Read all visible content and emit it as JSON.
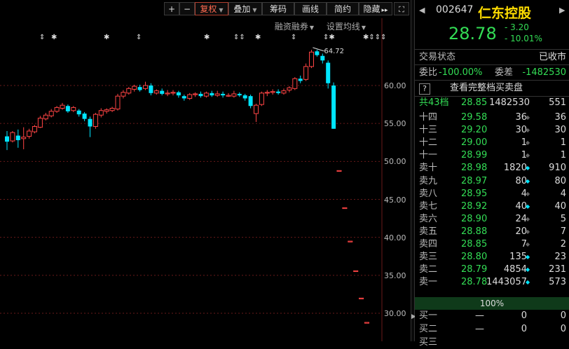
{
  "toolbar": {
    "plus": "+",
    "minus": "−",
    "fuquan": "复权",
    "diejia": "叠加",
    "chouma": "筹码",
    "huaxian": "画线",
    "jianyue": "简约",
    "yincang": "隐藏",
    "expand": "▸▸"
  },
  "subbar": {
    "rongzi": "融资融券",
    "ma": "设置均线"
  },
  "markers": [
    "⇕",
    "✱",
    "✱",
    "⇕",
    "✱",
    "⇕⇕",
    "✱",
    "⇕",
    "⇕✱",
    "✱⇕⇕⇕",
    "✱"
  ],
  "colors": {
    "up": "#ff4444",
    "down": "#00e5ff",
    "grid": "#6a1a1a",
    "green": "#33dd55",
    "name": "#ffdd00"
  },
  "chart_data": {
    "type": "candlestick",
    "y_ticks": [
      "60.00",
      "55.00",
      "50.00",
      "45.00",
      "40.00",
      "35.00",
      "30.00"
    ],
    "ylim": [
      28.5,
      65.5
    ],
    "high_label": "64.72",
    "candles": [
      {
        "o": 53.3,
        "c": 52.6,
        "h": 54.0,
        "l": 51.5
      },
      {
        "o": 52.7,
        "c": 53.8,
        "h": 54.0,
        "l": 52.5
      },
      {
        "o": 53.4,
        "c": 52.8,
        "h": 54.2,
        "l": 51.8
      },
      {
        "o": 53.0,
        "c": 53.2,
        "h": 54.5,
        "l": 51.6
      },
      {
        "o": 53.3,
        "c": 54.0,
        "h": 54.3,
        "l": 53.0
      },
      {
        "o": 53.9,
        "c": 54.6,
        "h": 54.8,
        "l": 53.7
      },
      {
        "o": 54.5,
        "c": 55.7,
        "h": 56.0,
        "l": 54.4
      },
      {
        "o": 55.6,
        "c": 56.1,
        "h": 56.4,
        "l": 55.4
      },
      {
        "o": 56.0,
        "c": 56.6,
        "h": 56.9,
        "l": 55.8
      },
      {
        "o": 56.6,
        "c": 57.1,
        "h": 57.3,
        "l": 56.4
      },
      {
        "o": 57.0,
        "c": 57.4,
        "h": 57.7,
        "l": 56.8
      },
      {
        "o": 57.3,
        "c": 56.6,
        "h": 57.5,
        "l": 56.4
      },
      {
        "o": 56.7,
        "c": 57.1,
        "h": 57.3,
        "l": 56.5
      },
      {
        "o": 56.7,
        "c": 56.2,
        "h": 56.9,
        "l": 55.9
      },
      {
        "o": 56.3,
        "c": 55.6,
        "h": 56.5,
        "l": 55.3
      },
      {
        "o": 55.6,
        "c": 54.6,
        "h": 55.9,
        "l": 53.2
      },
      {
        "o": 54.6,
        "c": 56.2,
        "h": 56.4,
        "l": 54.3
      },
      {
        "o": 56.1,
        "c": 56.7,
        "h": 57.0,
        "l": 55.8
      },
      {
        "o": 56.6,
        "c": 56.8,
        "h": 57.0,
        "l": 56.3
      },
      {
        "o": 56.7,
        "c": 57.0,
        "h": 57.2,
        "l": 56.5
      },
      {
        "o": 56.9,
        "c": 58.6,
        "h": 58.9,
        "l": 56.7
      },
      {
        "o": 58.6,
        "c": 59.1,
        "h": 59.4,
        "l": 58.3
      },
      {
        "o": 59.0,
        "c": 59.6,
        "h": 59.8,
        "l": 58.8
      },
      {
        "o": 59.5,
        "c": 59.9,
        "h": 60.1,
        "l": 59.2
      },
      {
        "o": 59.8,
        "c": 59.4,
        "h": 60.1,
        "l": 59.2
      },
      {
        "o": 59.6,
        "c": 60.0,
        "h": 60.5,
        "l": 59.4
      },
      {
        "o": 60.0,
        "c": 59.0,
        "h": 60.3,
        "l": 58.7
      },
      {
        "o": 59.0,
        "c": 59.3,
        "h": 59.5,
        "l": 58.8
      },
      {
        "o": 59.3,
        "c": 58.9,
        "h": 59.6,
        "l": 58.7
      },
      {
        "o": 58.9,
        "c": 59.0,
        "h": 59.4,
        "l": 58.6
      },
      {
        "o": 59.0,
        "c": 59.1,
        "h": 59.4,
        "l": 58.7
      },
      {
        "o": 59.1,
        "c": 58.7,
        "h": 59.3,
        "l": 58.4
      },
      {
        "o": 58.6,
        "c": 58.3,
        "h": 58.8,
        "l": 58.0
      },
      {
        "o": 58.3,
        "c": 58.8,
        "h": 59.0,
        "l": 58.1
      },
      {
        "o": 58.8,
        "c": 58.9,
        "h": 59.1,
        "l": 58.5
      },
      {
        "o": 58.9,
        "c": 58.6,
        "h": 59.2,
        "l": 58.4
      },
      {
        "o": 58.6,
        "c": 59.0,
        "h": 59.2,
        "l": 58.4
      },
      {
        "o": 59.0,
        "c": 58.7,
        "h": 59.3,
        "l": 58.5
      },
      {
        "o": 58.7,
        "c": 58.9,
        "h": 59.3,
        "l": 58.5
      },
      {
        "o": 58.9,
        "c": 58.7,
        "h": 59.2,
        "l": 58.4
      },
      {
        "o": 58.7,
        "c": 58.7,
        "h": 59.0,
        "l": 58.5
      },
      {
        "o": 58.6,
        "c": 58.9,
        "h": 59.3,
        "l": 58.4
      },
      {
        "o": 58.9,
        "c": 58.7,
        "h": 59.1,
        "l": 58.5
      },
      {
        "o": 58.7,
        "c": 58.3,
        "h": 58.9,
        "l": 58.0
      },
      {
        "o": 58.6,
        "c": 57.3,
        "h": 58.8,
        "l": 57.0
      },
      {
        "o": 56.3,
        "c": 57.4,
        "h": 57.6,
        "l": 55.2
      },
      {
        "o": 57.5,
        "c": 59.0,
        "h": 59.2,
        "l": 57.3
      },
      {
        "o": 59.0,
        "c": 59.1,
        "h": 59.4,
        "l": 58.6
      },
      {
        "o": 59.1,
        "c": 59.2,
        "h": 59.5,
        "l": 58.8
      },
      {
        "o": 59.2,
        "c": 59.0,
        "h": 59.5,
        "l": 58.8
      },
      {
        "o": 59.0,
        "c": 59.3,
        "h": 59.6,
        "l": 58.8
      },
      {
        "o": 59.4,
        "c": 59.7,
        "h": 59.9,
        "l": 59.1
      },
      {
        "o": 59.6,
        "c": 60.9,
        "h": 61.1,
        "l": 59.4
      },
      {
        "o": 60.9,
        "c": 60.6,
        "h": 61.3,
        "l": 60.3
      },
      {
        "o": 60.8,
        "c": 62.5,
        "h": 62.9,
        "l": 60.6
      },
      {
        "o": 62.5,
        "c": 64.4,
        "h": 64.7,
        "l": 62.3
      },
      {
        "o": 64.5,
        "c": 64.0,
        "h": 64.72,
        "l": 63.8
      },
      {
        "o": 63.9,
        "c": 63.3,
        "h": 64.2,
        "l": 62.9
      },
      {
        "o": 63.0,
        "c": 60.3,
        "h": 63.3,
        "l": 59.6
      },
      {
        "o": 60.0,
        "c": 54.3,
        "h": 60.4,
        "l": 54.3
      },
      {
        "o": 48.8,
        "c": 48.8,
        "h": 48.8,
        "l": 48.8
      },
      {
        "o": 43.9,
        "c": 43.9,
        "h": 43.9,
        "l": 43.9
      },
      {
        "o": 39.5,
        "c": 39.5,
        "h": 39.5,
        "l": 39.5
      },
      {
        "o": 35.6,
        "c": 35.6,
        "h": 35.6,
        "l": 35.6
      },
      {
        "o": 32.0,
        "c": 32.0,
        "h": 32.0,
        "l": 32.0
      },
      {
        "o": 28.8,
        "c": 28.8,
        "h": 28.8,
        "l": 28.8
      }
    ]
  },
  "quote": {
    "code": "002647",
    "name": "仁东控股",
    "price": "28.78",
    "change": "- 3.20",
    "pct": "- 10.01%",
    "status_label": "交易状态",
    "status_value": "已收市",
    "weibi_label": "委比",
    "weibi_value": "-100.00%",
    "weicha_label": "委差",
    "weicha_value": "-1482530",
    "view_all": "查看完整档买卖盘",
    "help": "?",
    "total_label": "共43档",
    "total_price": "28.85",
    "total_vol": "1482530",
    "total_right": "551",
    "ask_rows": [
      {
        "label": "十四",
        "price": "29.58",
        "vol": "36",
        "right": "36",
        "dot": "◆",
        "dot_color": "#666"
      },
      {
        "label": "十三",
        "price": "29.20",
        "vol": "30",
        "right": "30",
        "dot": "◆",
        "dot_color": "#666"
      },
      {
        "label": "十二",
        "price": "29.00",
        "vol": "1",
        "right": "1",
        "dot": "◆",
        "dot_color": "#666"
      },
      {
        "label": "十一",
        "price": "28.99",
        "vol": "1",
        "right": "1",
        "dot": "◆",
        "dot_color": "#666"
      },
      {
        "label": "卖十",
        "price": "28.98",
        "vol": "1820",
        "right": "910",
        "dot": "◆",
        "dot_color": "#00e5ff"
      },
      {
        "label": "卖九",
        "price": "28.97",
        "vol": "80",
        "right": "80",
        "dot": "◆",
        "dot_color": "#00e5ff"
      },
      {
        "label": "卖八",
        "price": "28.95",
        "vol": "4",
        "right": "4",
        "dot": "◆",
        "dot_color": "#666"
      },
      {
        "label": "卖七",
        "price": "28.92",
        "vol": "40",
        "right": "40",
        "dot": "◆",
        "dot_color": "#00e5ff"
      },
      {
        "label": "卖六",
        "price": "28.90",
        "vol": "24",
        "right": "5",
        "dot": "◆",
        "dot_color": "#666"
      },
      {
        "label": "卖五",
        "price": "28.88",
        "vol": "20",
        "right": "7",
        "dot": "◆",
        "dot_color": "#666"
      },
      {
        "label": "卖四",
        "price": "28.85",
        "vol": "7",
        "right": "2",
        "dot": "◆",
        "dot_color": "#666"
      },
      {
        "label": "卖三",
        "price": "28.80",
        "vol": "135",
        "right": "23",
        "dot": "◆",
        "dot_color": "#00e5ff"
      },
      {
        "label": "卖二",
        "price": "28.79",
        "vol": "4854",
        "right": "231",
        "dot": "◆",
        "dot_color": "#00e5ff"
      },
      {
        "label": "卖一",
        "price": "28.78",
        "vol": "1443057",
        "right": "573",
        "dot": "◆",
        "dot_color": "#00e5ff"
      }
    ],
    "ratio": "100%",
    "bid_rows": [
      {
        "label": "买一",
        "price": "—",
        "vol": "0",
        "right": "0"
      },
      {
        "label": "买二",
        "price": "—",
        "vol": "0",
        "right": "0"
      },
      {
        "label": "买三",
        "price": "",
        "vol": "",
        "right": ""
      }
    ]
  }
}
